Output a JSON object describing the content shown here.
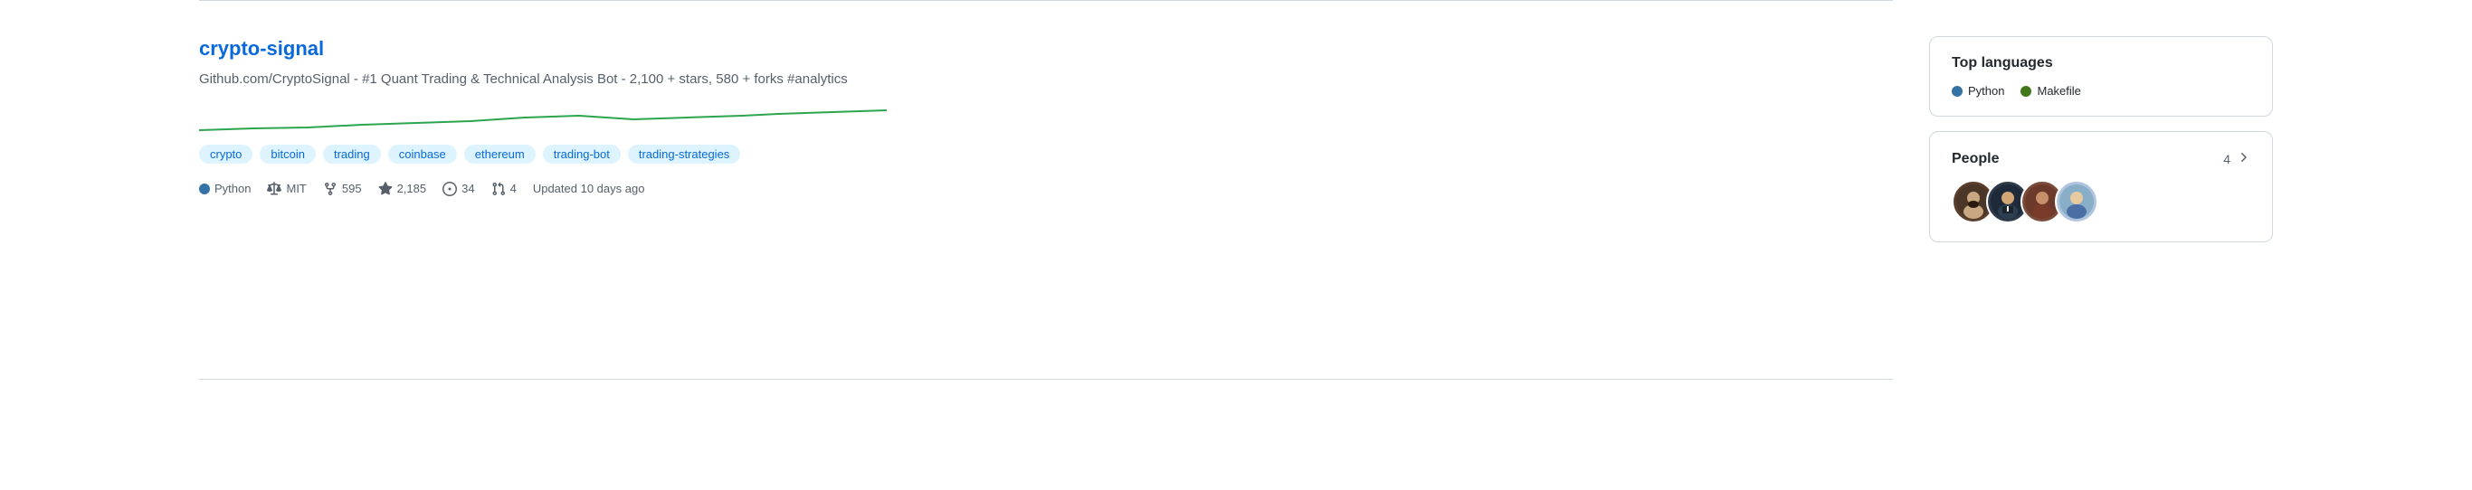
{
  "repo": {
    "title": "crypto-signal",
    "description": "Github.com/CryptoSignal - #1 Quant Trading & Technical Analysis Bot - 2,100 + stars, 580 + forks #analytics",
    "tags": [
      "crypto",
      "bitcoin",
      "trading",
      "coinbase",
      "ethereum",
      "trading-bot",
      "trading-strategies"
    ],
    "language": "Python",
    "license": "MIT",
    "forks": "595",
    "stars": "2,185",
    "issues": "34",
    "pull_requests": "4",
    "updated": "Updated 10 days ago"
  },
  "sidebar": {
    "top_languages": {
      "title": "Top languages",
      "languages": [
        {
          "name": "Python",
          "dot_class": "lang-dot-python"
        },
        {
          "name": "Makefile",
          "dot_class": "lang-dot-makefile"
        }
      ]
    },
    "people": {
      "title": "People",
      "count": "4",
      "avatars": [
        {
          "label": "person 1"
        },
        {
          "label": "person 2"
        },
        {
          "label": "person 3"
        },
        {
          "label": "person 4"
        }
      ]
    }
  }
}
